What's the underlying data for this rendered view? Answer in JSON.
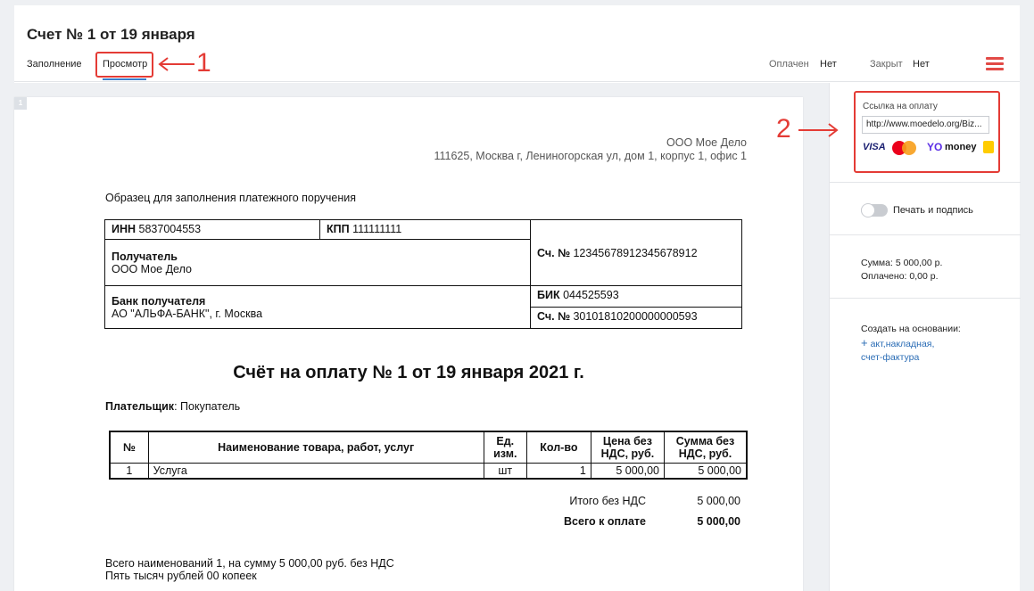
{
  "header": {
    "title": "Счет № 1 от 19 января",
    "tabs": [
      {
        "label": "Заполнение"
      },
      {
        "label": "Просмотр"
      }
    ],
    "paid_label": "Оплачен",
    "paid_value": "Нет",
    "closed_label": "Закрыт",
    "closed_value": "Нет"
  },
  "annotations": {
    "one": "1",
    "two": "2"
  },
  "document": {
    "page_number": "1",
    "company_name": "ООО Мое Дело",
    "company_address": "111625, Москва г, Лениногорская ул, дом 1, корпус 1, офис 1",
    "sample_caption": "Образец для заполнения платежного поручения",
    "bank": {
      "inn_label": "ИНН",
      "inn": "5837004553",
      "kpp_label": "КПП",
      "kpp": "111111111",
      "recipient_label": "Получатель",
      "recipient": "ООО Мое Дело",
      "account_label": "Сч. №",
      "account": "12345678912345678912",
      "bank_label": "Банк получателя",
      "bank_name": "АО \"АЛЬФА-БАНК\", г. Москва",
      "bik_label": "БИК",
      "bik": "044525593",
      "corr_label": "Сч. №",
      "corr_account": "30101810200000000593"
    },
    "invoice_title": "Счёт на оплату № 1 от 19 января 2021 г.",
    "payer_label": "Плательщик",
    "payer": ": Покупатель",
    "items": {
      "headers": [
        "№",
        "Наименование товара, работ, услуг",
        "Ед. изм.",
        "Кол-во",
        "Цена без НДС, руб.",
        "Сумма без НДС, руб."
      ],
      "rows": [
        {
          "n": "1",
          "name": "Услуга",
          "unit": "шт",
          "qty": "1",
          "price": "5 000,00",
          "sum": "5 000,00"
        }
      ]
    },
    "totals": {
      "subtotal_label": "Итого без НДС",
      "subtotal": "5 000,00",
      "total_label": "Всего к оплате",
      "total": "5 000,00"
    },
    "summary_line1": "Всего наименований 1, на сумму 5 000,00 руб. без НДС",
    "summary_line2": "Пять тысяч рублей 00 копеек"
  },
  "sidebar": {
    "pay_link_label": "Ссылка на оплату",
    "pay_link_value": "http://www.moedelo.org/Biz...",
    "logos": {
      "visa": "VISA",
      "yoo": "YO",
      "money": "money"
    },
    "print_sign_label": "Печать и подпись",
    "print_sign_on": false,
    "sum_line": "Сумма: 5 000,00 р.",
    "paid_line": "Оплачено: 0,00 р.",
    "create_label": "Создать на основании:",
    "create_link_1": "акт,накладная,",
    "create_link_2": "счет-фактура"
  },
  "colors": {
    "accent": "#3a7fcb",
    "annotation": "#e43b35",
    "link": "#2a6cb5",
    "menu": "#e24a46"
  }
}
